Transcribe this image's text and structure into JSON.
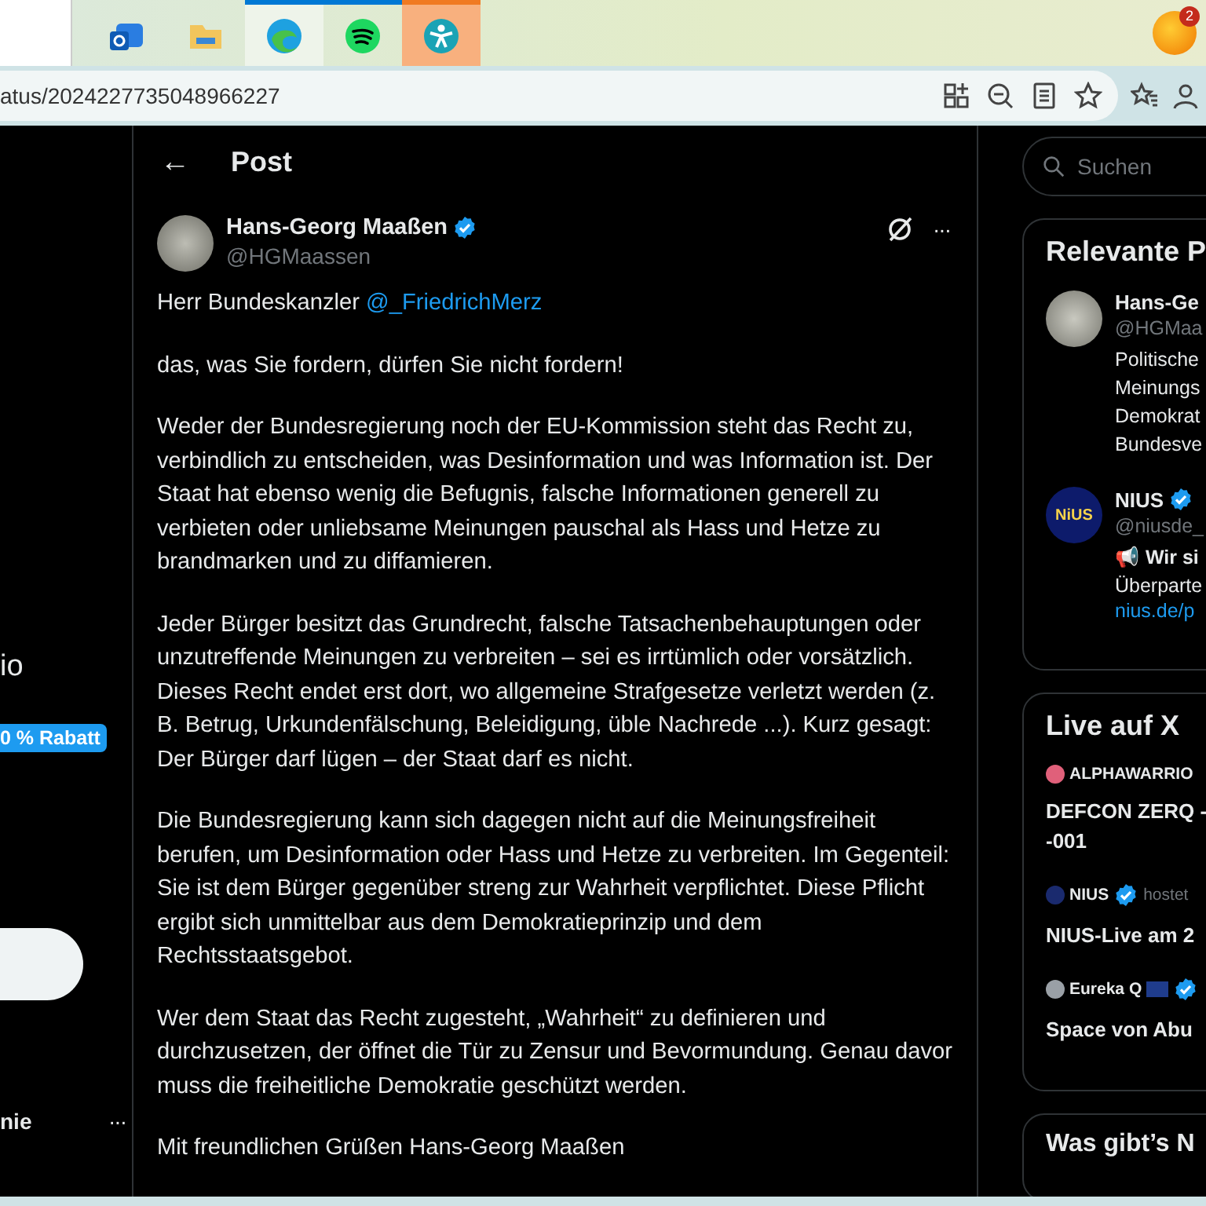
{
  "taskbar": {
    "apps": [
      {
        "kind": "mail",
        "selected": false,
        "running": false
      },
      {
        "kind": "folder",
        "selected": false,
        "running": false
      },
      {
        "kind": "browser",
        "selected": true,
        "running": true
      },
      {
        "kind": "music",
        "selected": false,
        "running": true
      },
      {
        "kind": "person",
        "selected": true,
        "running": true
      }
    ],
    "notification_badge": "2"
  },
  "browser": {
    "url": "atus/2024227735048966227"
  },
  "left_nav": {
    "label": "io",
    "badge": "0 % Rabatt",
    "account_name": "nie",
    "more": "···"
  },
  "post": {
    "back": "←",
    "title": "Post",
    "author": {
      "name": "Hans-Georg Maaßen",
      "handle": "@HGMaassen",
      "verified": true
    },
    "more": "···",
    "greeting": {
      "text": "Herr Bundeskanzler",
      "mention": "@_FriedrichMerz"
    },
    "paragraphs": [
      "das, was Sie fordern, dürfen Sie nicht fordern!",
      "Weder der Bundesregierung noch der EU-Kommission steht das Recht zu, verbindlich zu entscheiden, was Desinformation und was Information ist. Der Staat hat ebenso wenig die Befugnis, falsche Informationen generell zu verbieten oder unliebsame Meinungen pauschal als Hass und Hetze zu brandmarken und zu diffamieren.",
      "Jeder Bürger besitzt das Grundrecht, falsche Tatsachenbehauptungen oder unzutreffende Meinungen zu verbreiten – sei es irrtümlich oder vorsätzlich. Dieses Recht endet erst dort, wo allgemeine Strafgesetze verletzt werden (z. B. Betrug, Urkundenfälschung, Beleidigung, üble Nachrede ...). Kurz gesagt: Der Bürger darf lügen – der Staat darf es nicht.",
      "Die Bundesregierung kann sich dagegen nicht auf die Meinungsfreiheit berufen, um Desinformation oder Hass und Hetze zu verbreiten. Im Gegenteil: Sie ist dem Bürger gegenüber streng zur Wahrheit verpflichtet. Diese Pflicht ergibt sich unmittelbar aus dem Demokratieprinzip und dem Rechtsstaatsgebot.",
      "Wer dem Staat das Recht zugesteht, „Wahrheit“ zu definieren und durchzusetzen, der öffnet die Tür zu Zensur und Bevormundung. Genau davor muss die freiheitliche Demokratie geschützt werden.",
      "Mit freundlichen Grüßen Hans-Georg Maaßen"
    ]
  },
  "search": {
    "placeholder": "Suchen"
  },
  "relevant": {
    "title": "Relevante P",
    "people": [
      {
        "kind": "photo",
        "name": "Hans-Ge",
        "handle": "@HGMaa",
        "bio": [
          "Politische",
          "Meinungs",
          "Demokrat",
          "Bundesve"
        ]
      },
      {
        "kind": "logo",
        "logo": "NiUS",
        "name": "NIUS",
        "handle": "@niusde_",
        "verified": true,
        "bio": [
          "📢 **Wir si**",
          "Überparte"
        ],
        "link": "nius.de/p"
      }
    ]
  },
  "live": {
    "title": "Live auf X",
    "items": [
      {
        "host": "ALPHAWARRIO",
        "title": "DEFCON ZERQ -\n-001",
        "color": "#e0607a"
      },
      {
        "host": "NIUS",
        "verified": true,
        "hosting": "hostet",
        "title": "NIUS-Live am 2",
        "color": "#1a2a6e"
      },
      {
        "host": "Eureka Q",
        "verified": true,
        "flag": true,
        "title": "Space von Abu",
        "color": "#9aa0a6"
      }
    ]
  },
  "next_card": {
    "title": "Was gibt’s N"
  }
}
